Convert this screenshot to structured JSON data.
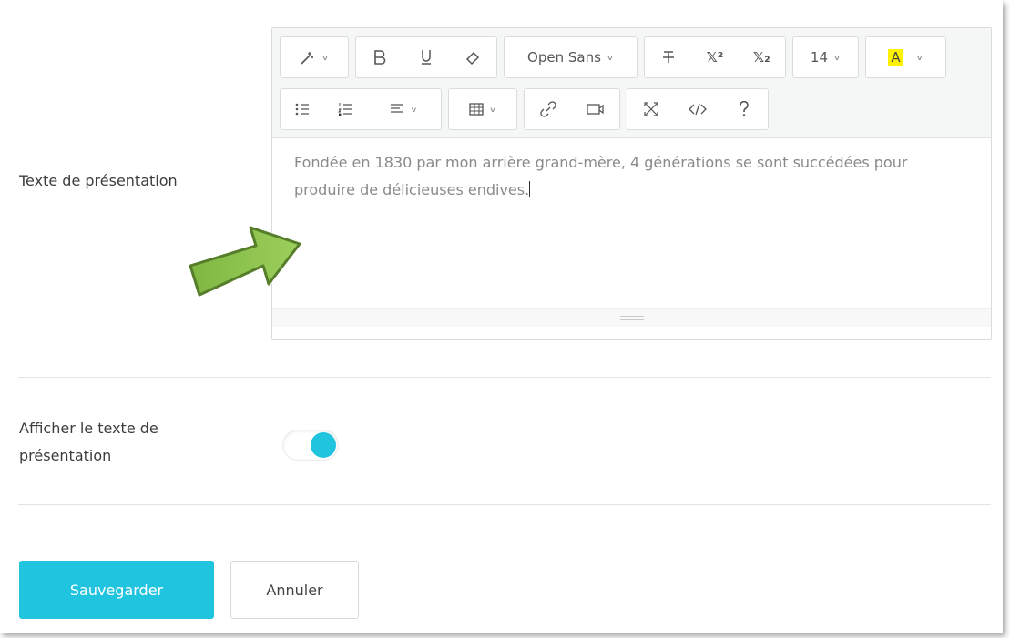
{
  "form": {
    "presentation_label": "Texte de présentation",
    "show_label": "Afficher le texte de présentation",
    "show_toggle_on": true
  },
  "editor": {
    "toolbar_row1": {
      "font_name": "Open Sans",
      "font_size": "14",
      "color_button": "A",
      "superscript": "𝕏²",
      "subscript": "𝕏₂"
    },
    "content_text": "Fondée en 1830 par mon arrière grand-mère, 4 générations se sont succédées pour produire de délicieuses endives."
  },
  "actions": {
    "save_label": "Sauvegarder",
    "cancel_label": "Annuler"
  },
  "colors": {
    "accent": "#21c4df",
    "highlight": "#fff200",
    "arrow": "#8bc34a"
  }
}
